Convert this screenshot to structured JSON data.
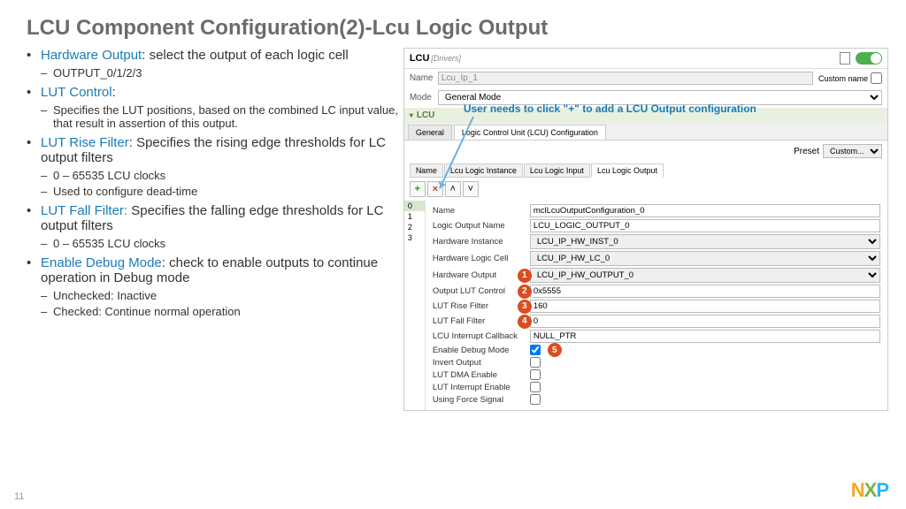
{
  "title": "LCU Component Configuration(2)-Lcu Logic Output",
  "bullets": [
    {
      "term": "Hardware Output",
      "text": ": select the output of each logic cell",
      "subs": [
        "OUTPUT_0/1/2/3"
      ]
    },
    {
      "term": "LUT Control",
      "text": ":",
      "subs": [
        "Specifies the LUT positions, based on the combined LC input value, that result in assertion of this output."
      ]
    },
    {
      "term": "LUT Rise Filter",
      "text": ": Specifies the rising edge thresholds for LC output filters",
      "subs": [
        "0 – 65535 LCU clocks",
        "Used to configure dead-time"
      ]
    },
    {
      "term": "LUT Fall Filter:",
      "text": " Specifies the falling edge thresholds for LC output filters",
      "subs": [
        "0 – 65535 LCU clocks"
      ]
    },
    {
      "term": "Enable Debug Mode",
      "text": ": check to enable outputs to continue operation in Debug mode",
      "subs": [
        "Unchecked: Inactive",
        "Checked: Continue normal operation"
      ]
    }
  ],
  "callout": "User needs to click \"+\" to add a LCU Output configuration",
  "panel": {
    "lcu": "LCU",
    "drivers": "[Drivers]",
    "nameLabel": "Name",
    "nameVal": "Lcu_Ip_1",
    "modeLabel": "Mode",
    "modeVal": "General Mode",
    "customName": "Custom name",
    "section": "LCU",
    "tabs": [
      "General",
      "Logic Control Unit (LCU) Configuration"
    ],
    "presetLabel": "Preset",
    "presetVal": "Custom...",
    "innerTabs": [
      "Name",
      "Lcu Logic Instance",
      "Lcu Logic Input",
      "Lcu Logic Output"
    ],
    "indices": [
      "0",
      "1",
      "2",
      "3"
    ],
    "fields": {
      "name": {
        "l": "Name",
        "v": "mclLcuOutputConfiguration_0"
      },
      "logicOut": {
        "l": "Logic Output Name",
        "v": "LCU_LOGIC_OUTPUT_0"
      },
      "hwInst": {
        "l": "Hardware Instance",
        "v": "LCU_IP_HW_INST_0"
      },
      "hwCell": {
        "l": "Hardware Logic Cell",
        "v": "LCU_IP_HW_LC_0"
      },
      "hwOut": {
        "l": "Hardware Output",
        "v": "LCU_IP_HW_OUTPUT_0"
      },
      "lutCtrl": {
        "l": "Output LUT Control",
        "v": "0x5555"
      },
      "lutRise": {
        "l": "LUT Rise Filter",
        "v": "160"
      },
      "lutFall": {
        "l": "LUT Fall Filter",
        "v": "0"
      },
      "intCb": {
        "l": "LCU Interrupt Callback",
        "v": "NULL_PTR"
      },
      "debug": {
        "l": "Enable Debug Mode"
      },
      "invert": {
        "l": "Invert Output"
      },
      "dma": {
        "l": "LUT DMA Enable"
      },
      "intEn": {
        "l": "LUT Interrupt Enable"
      },
      "force": {
        "l": "Using Force Signal"
      }
    }
  },
  "badges": [
    "1",
    "2",
    "3",
    "4",
    "5"
  ],
  "pageNum": "11"
}
